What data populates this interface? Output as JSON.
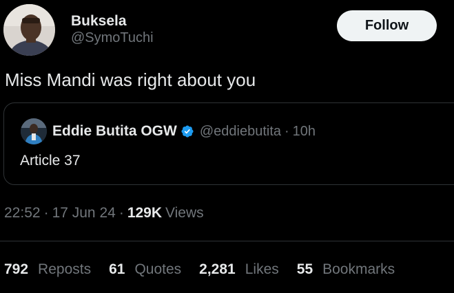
{
  "author": {
    "name": "Buksela",
    "handle": "@SymoTuchi"
  },
  "follow_button": {
    "label": "Follow"
  },
  "tweet": {
    "text": "Miss Mandi was right about you"
  },
  "quoted_tweet": {
    "name": "Eddie Butita OGW",
    "verified_icon": "verified-badge-icon",
    "handle": "@eddiebutita",
    "separator": "·",
    "time": "10h",
    "text": "Article 37"
  },
  "meta": {
    "time": "22:52",
    "separator": "·",
    "date": "17 Jun 24",
    "views_count": "129K",
    "views_label": "Views"
  },
  "stats": [
    {
      "count": "792",
      "label": "Reposts"
    },
    {
      "count": "61",
      "label": "Quotes"
    },
    {
      "count": "2,281",
      "label": "Likes"
    },
    {
      "count": "55",
      "label": "Bookmarks"
    }
  ],
  "colors": {
    "background": "#000000",
    "text_primary": "#e7e9ea",
    "text_secondary": "#71767b",
    "border": "#2f3336",
    "follow_bg": "#eff3f4",
    "verified_blue": "#1d9bf0"
  }
}
